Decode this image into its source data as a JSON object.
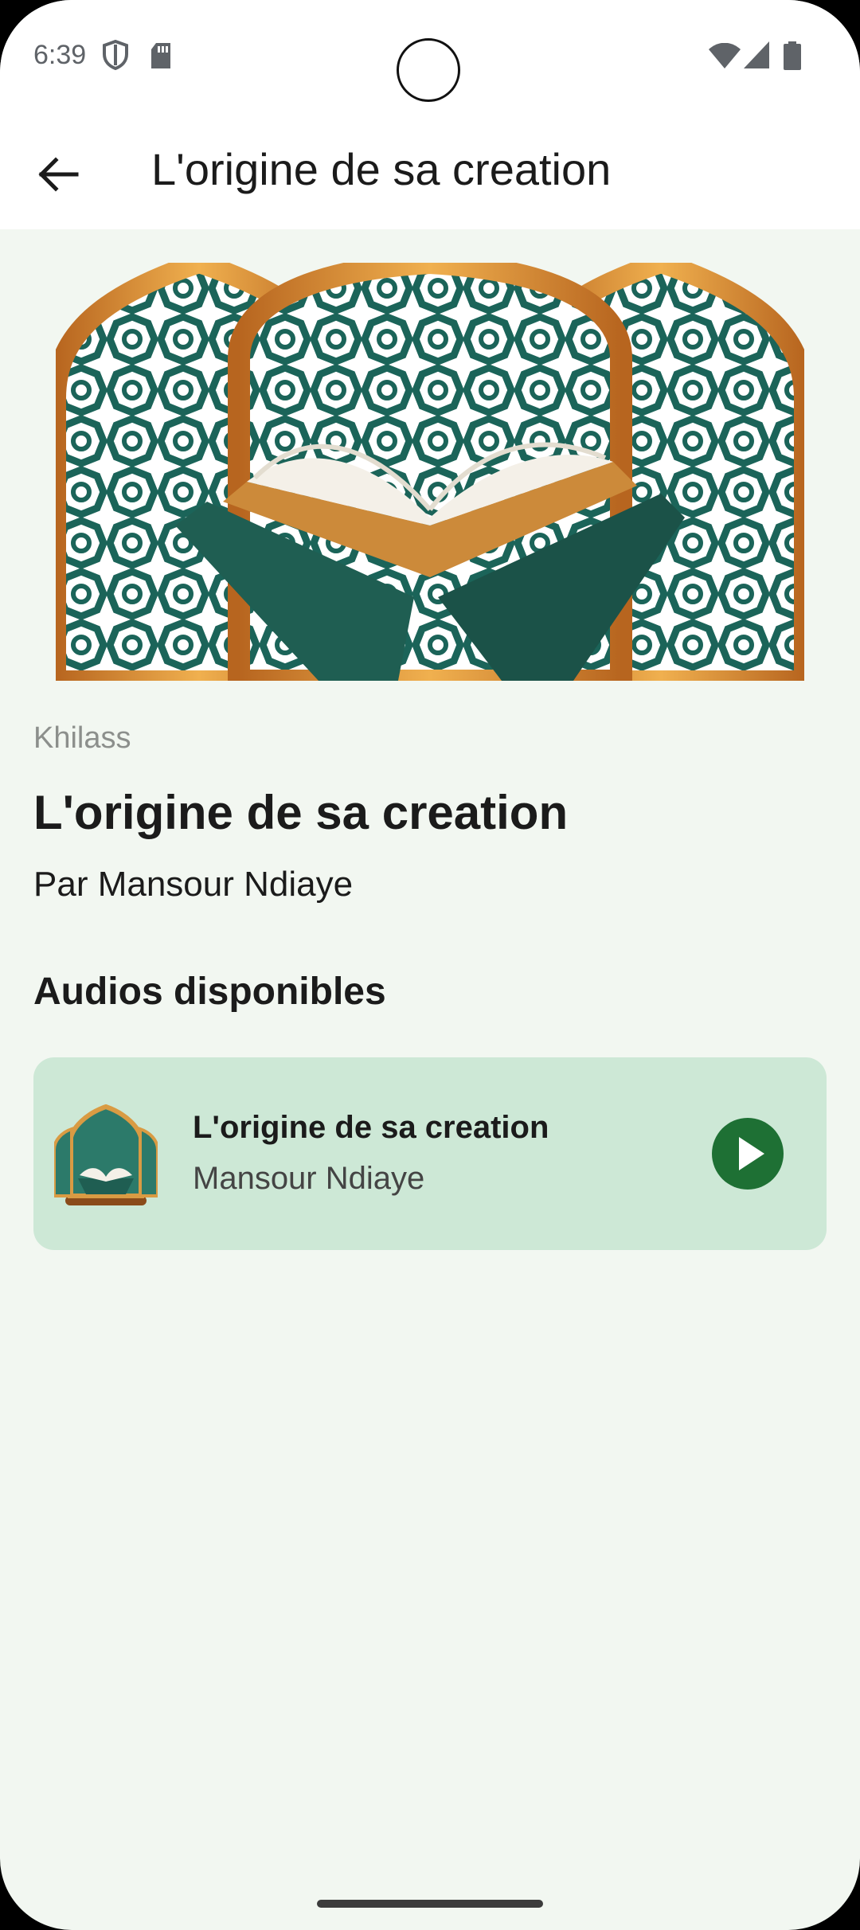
{
  "status_bar": {
    "time": "6:39"
  },
  "app_bar": {
    "title": "L'origine de sa creation"
  },
  "detail": {
    "category": "Khilass",
    "title": "L'origine de sa creation",
    "author": "Par Mansour Ndiaye"
  },
  "audios": {
    "section_title": "Audios disponibles",
    "items": [
      {
        "title": "L'origine de sa creation",
        "subtitle": "Mansour Ndiaye"
      }
    ]
  },
  "colors": {
    "accent": "#1e7034",
    "card": "#cde8d6",
    "background": "#f2f7f1"
  }
}
